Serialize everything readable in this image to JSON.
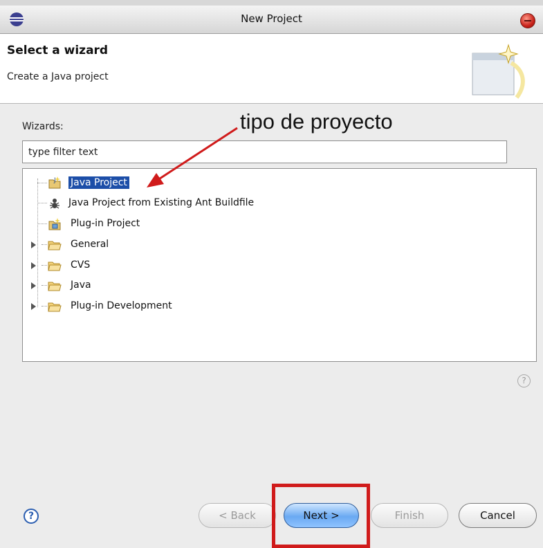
{
  "window": {
    "title": "New Project"
  },
  "header": {
    "title": "Select a wizard",
    "description": "Create a Java project"
  },
  "wizards": {
    "label": "Wizards:",
    "filter_value": "type filter text",
    "items": [
      {
        "label": "Java Project",
        "icon": "java-project-icon",
        "selected": true
      },
      {
        "label": "Java Project from Existing Ant Buildfile",
        "icon": "ant-icon"
      },
      {
        "label": "Plug-in Project",
        "icon": "plugin-project-icon"
      },
      {
        "label": "General",
        "icon": "folder-icon",
        "expandable": true
      },
      {
        "label": "CVS",
        "icon": "folder-icon",
        "expandable": true
      },
      {
        "label": "Java",
        "icon": "folder-icon",
        "expandable": true
      },
      {
        "label": "Plug-in Development",
        "icon": "folder-icon",
        "expandable": true
      }
    ]
  },
  "annotation": {
    "text": "tipo de proyecto",
    "color": "#d01b1b"
  },
  "help": {
    "small_glyph": "?",
    "button_glyph": "?"
  },
  "buttons": {
    "back": "< Back",
    "next": "Next >",
    "finish": "Finish",
    "cancel": "Cancel"
  },
  "colors": {
    "selection": "#1c4ea8",
    "highlight_box": "#d01b1b",
    "next_button": "#6aa9f2"
  }
}
